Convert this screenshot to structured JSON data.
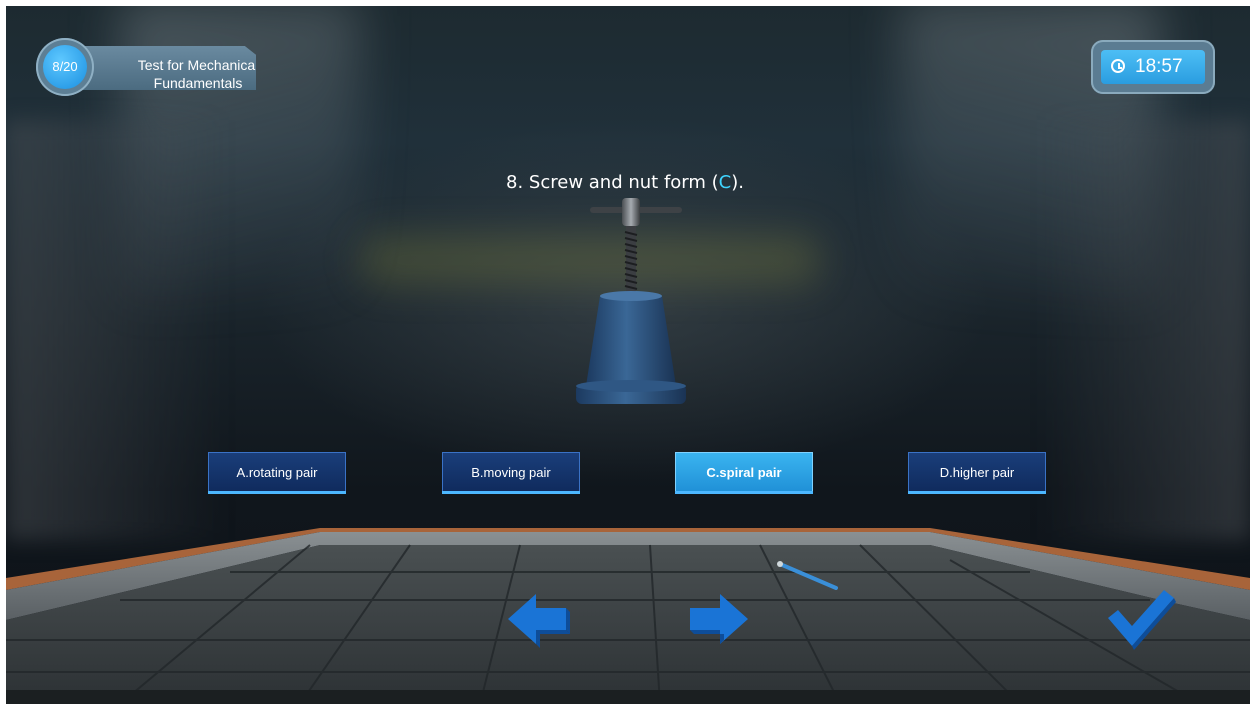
{
  "header": {
    "progress": "8/20",
    "title": "Test for Mechanical Fundamentals"
  },
  "timer": {
    "icon": "clock-icon",
    "time": "18:57"
  },
  "question": {
    "prefix": "8. Screw and nut form (",
    "answer": "C",
    "suffix": ")."
  },
  "options": [
    {
      "label": "A.rotating pair",
      "selected": false
    },
    {
      "label": "B.moving pair",
      "selected": false
    },
    {
      "label": "C.spiral pair",
      "selected": true
    },
    {
      "label": "D.higher pair",
      "selected": false
    }
  ],
  "nav": {
    "prev_icon": "arrow-left-icon",
    "next_icon": "arrow-right-icon",
    "confirm_icon": "checkmark-icon"
  },
  "colors": {
    "accent": "#3fd4ff",
    "button_bg": "#0f2a5c",
    "button_selected": "#2aa0e6"
  }
}
